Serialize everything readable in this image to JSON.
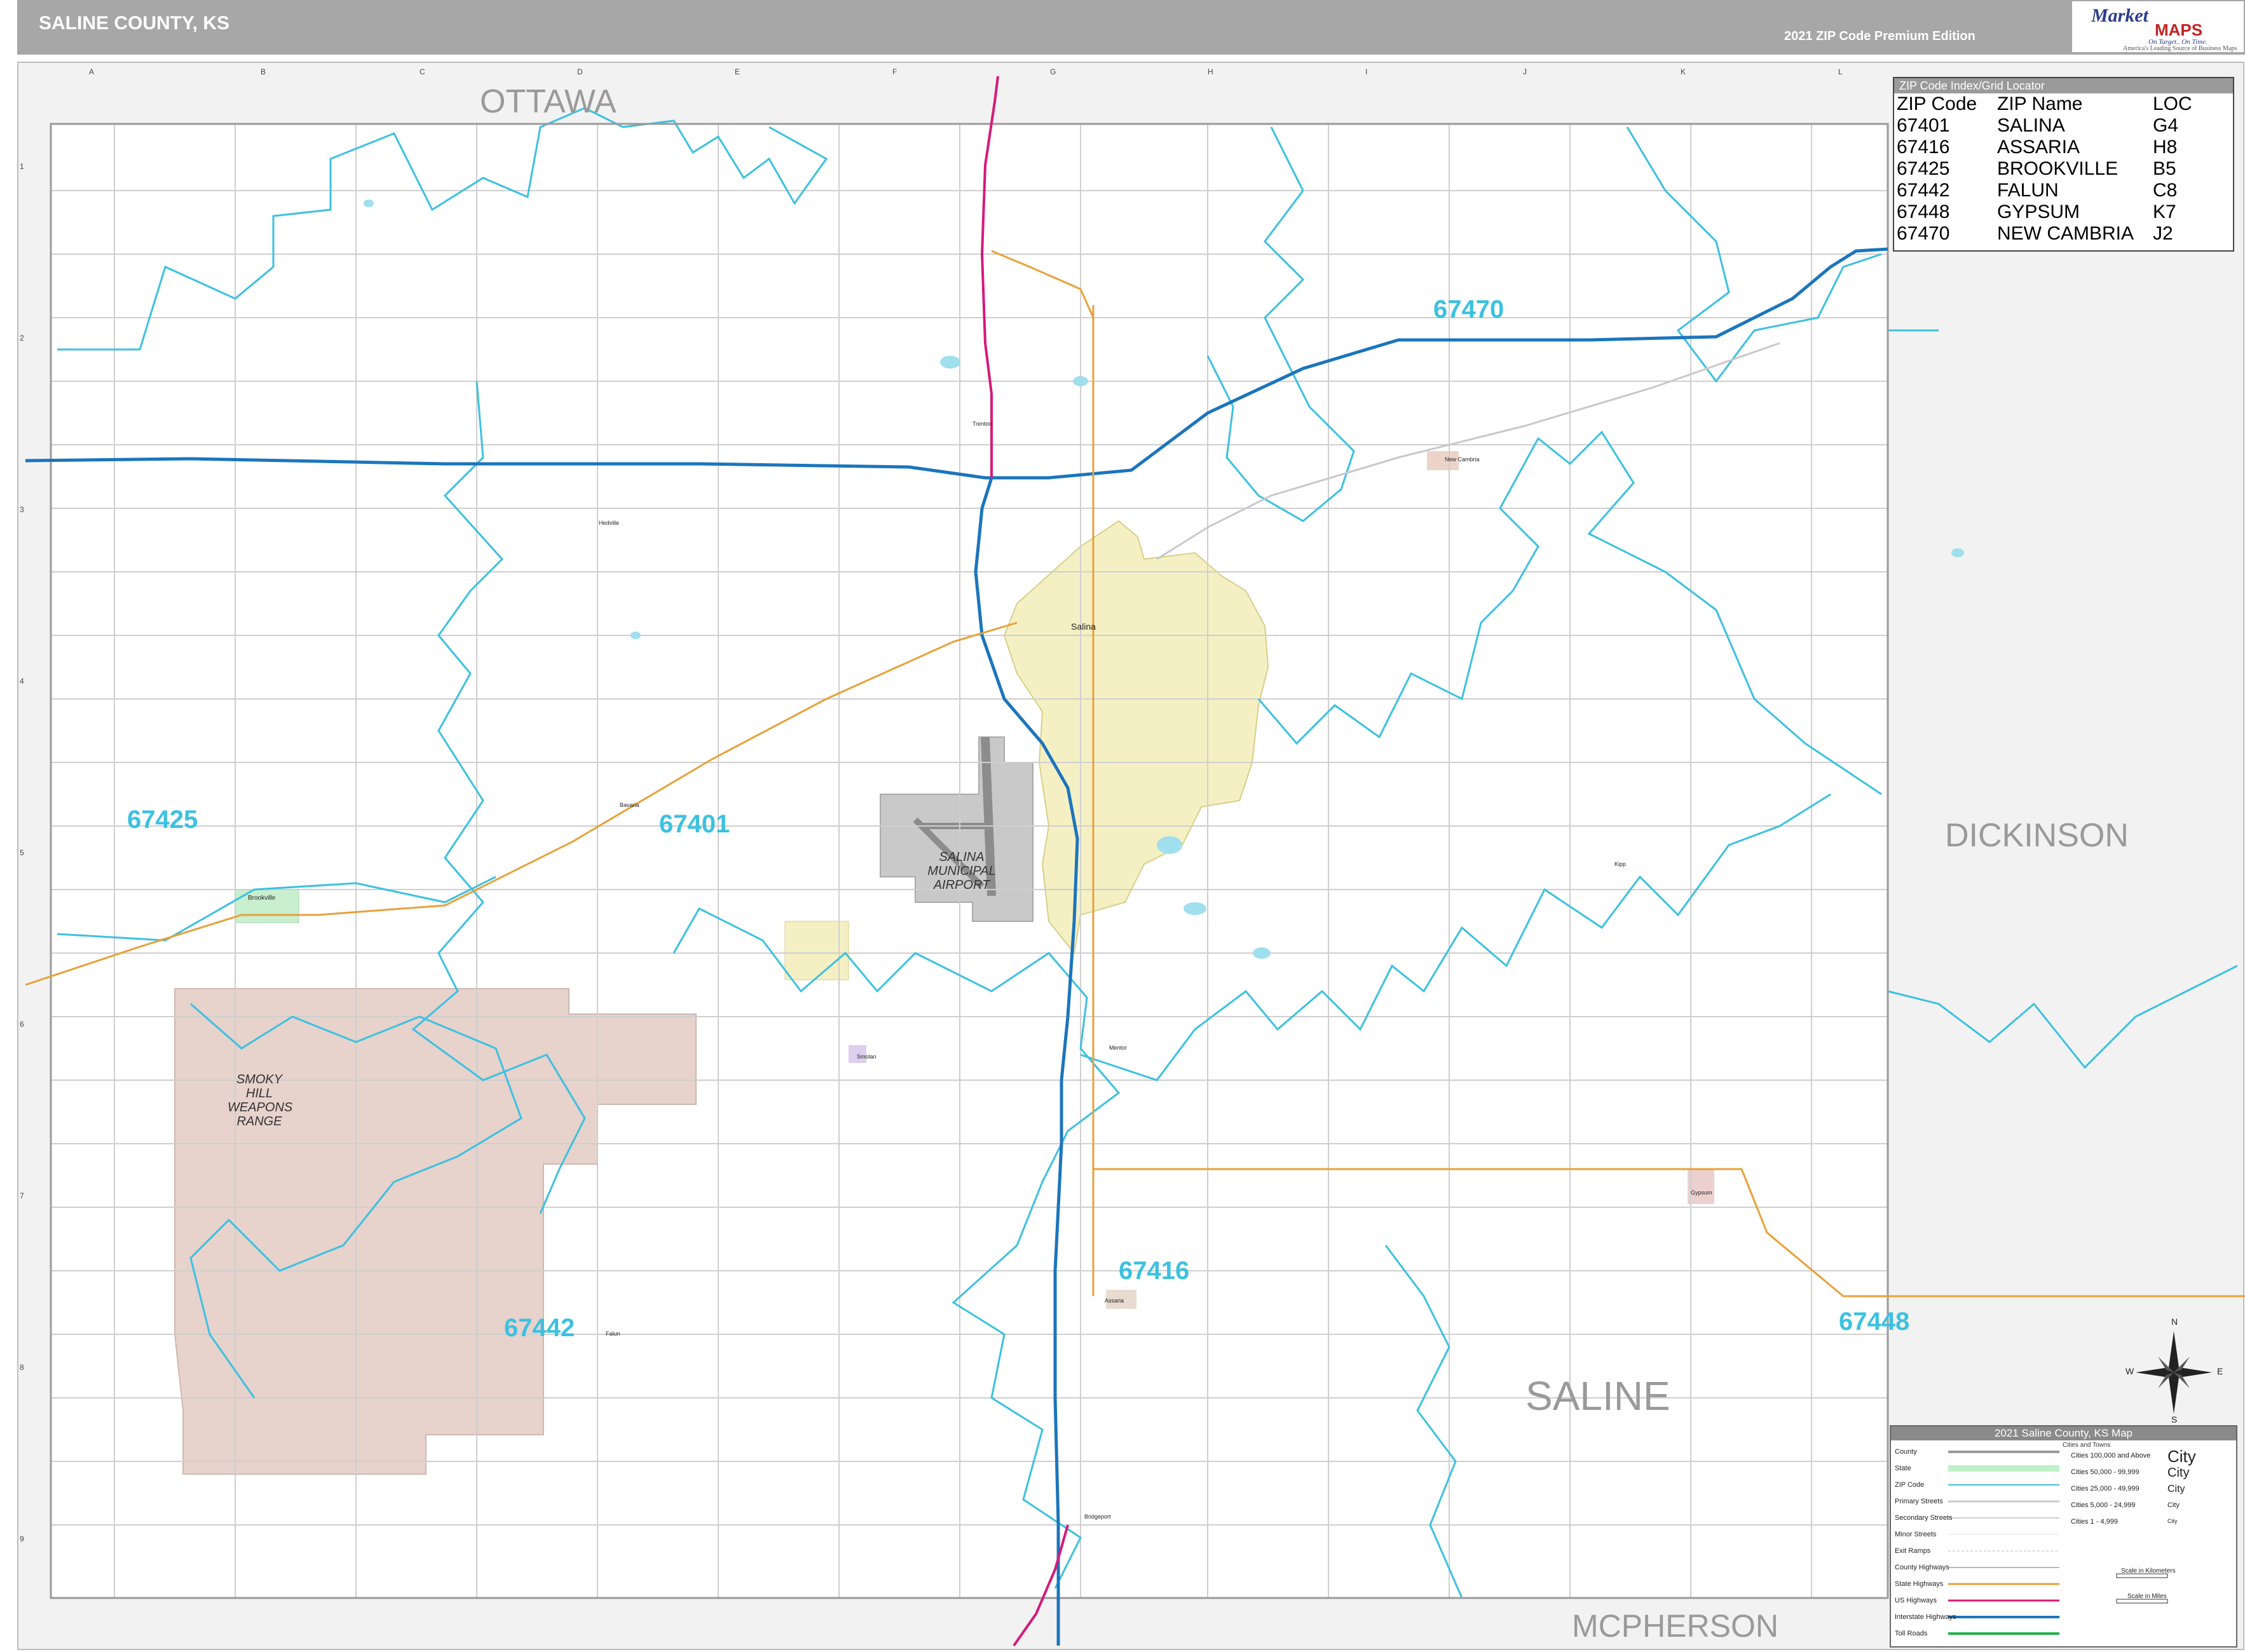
{
  "header": {
    "title": "SALINE COUNTY, KS",
    "edition": "2021 ZIP Code Premium Edition"
  },
  "logo": {
    "market": "Market",
    "maps": "MAPS",
    "tagline": "On Target.. On Time.",
    "tagline2": "America's Leading Source of Business Maps"
  },
  "zip_index": {
    "title": "ZIP Code Index/Grid Locator",
    "columns": [
      "ZIP Code",
      "ZIP Name",
      "LOC"
    ],
    "rows": [
      [
        "67401",
        "SALINA",
        "G4"
      ],
      [
        "67416",
        "ASSARIA",
        "H8"
      ],
      [
        "67425",
        "BROOKVILLE",
        "B5"
      ],
      [
        "67442",
        "FALUN",
        "C8"
      ],
      [
        "67448",
        "GYPSUM",
        "K7"
      ],
      [
        "67470",
        "NEW CAMBRIA",
        "J2"
      ]
    ]
  },
  "counties": {
    "north": "OTTAWA",
    "east": "DICKINSON",
    "south": "MCPHERSON",
    "center": "SALINE"
  },
  "zip_labels": {
    "z67470": "67470",
    "z67425": "67425",
    "z67401": "67401",
    "z67416": "67416",
    "z67442": "67442",
    "z67448": "67448"
  },
  "cities": {
    "salina": "Salina",
    "brookville": "Brookville",
    "new_cambria": "New Cambria",
    "assaria": "Assaria",
    "gypsum": "Gypsum",
    "falun": "Falun",
    "smolan": "Smolan",
    "mentor": "Mentor",
    "bavaria": "Bavaria",
    "kipp": "Kipp",
    "bridgeport": "Bridgeport",
    "hedville": "Hedville",
    "trenton": "Trenton"
  },
  "features": {
    "weapons_range": [
      "SMOKY",
      "HILL",
      "WEAPONS",
      "RANGE"
    ],
    "airport": [
      "SALINA",
      "MUNICIPAL",
      "AIRPORT"
    ]
  },
  "grid": {
    "columns": [
      "A",
      "B",
      "C",
      "D",
      "E",
      "F",
      "G",
      "H",
      "I",
      "J",
      "K",
      "L"
    ],
    "rows": [
      "1",
      "2",
      "3",
      "4",
      "5",
      "6",
      "7",
      "8",
      "9"
    ]
  },
  "legend": {
    "title": "2021 Saline County, KS Map",
    "cities_header": "Cities and Towns",
    "items": [
      "County",
      "State",
      "ZIP Code",
      "Primary Streets",
      "Secondary Streets",
      "Minor Streets",
      "Exit Ramps",
      "County Highways",
      "State Highways",
      "US Highways",
      "Interstate Highways",
      "Toll Roads"
    ],
    "city_classes": [
      "Cities 100,000 and Above",
      "Cities 50,000 - 99,999",
      "Cities 25,000 - 49,999",
      "Cities 5,000 - 24,999",
      "Cities 1 - 4,999"
    ],
    "city_samples": [
      "City",
      "City",
      "City",
      "City",
      "City"
    ],
    "scale_km": "Scale in Kilometers",
    "scale_mi": "Scale in Miles"
  },
  "compass": {
    "n": "N",
    "s": "S",
    "e": "E",
    "w": "W"
  },
  "colors": {
    "zip_boundary": "#3cc1e0",
    "interstate": "#1b75bc",
    "us_highway": "#d6197a",
    "state_highway": "#e8a13a",
    "city_fill": "#f5f0c4",
    "range_fill": "#e7d2cc",
    "airport_fill": "#c9c9c9"
  }
}
